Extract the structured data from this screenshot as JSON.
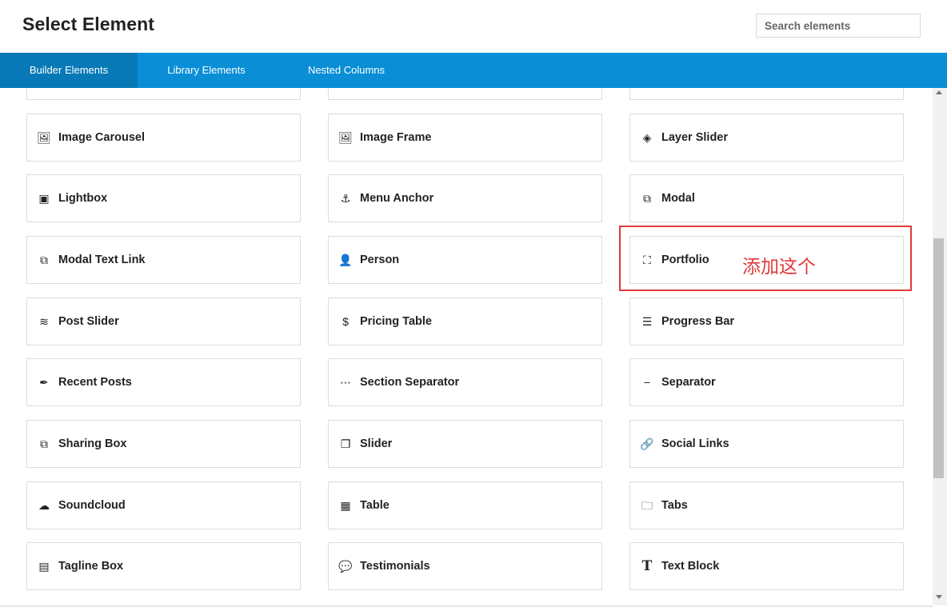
{
  "header": {
    "title": "Select Element",
    "search_placeholder": "Search elements"
  },
  "tabs": [
    {
      "label": "Builder Elements",
      "active": true
    },
    {
      "label": "Library Elements",
      "active": false
    },
    {
      "label": "Nested Columns",
      "active": false
    }
  ],
  "elements": [
    {
      "label": "Image Carousel",
      "icon": "image-icon",
      "glyph": "🖼"
    },
    {
      "label": "Image Frame",
      "icon": "image-icon",
      "glyph": "🖼"
    },
    {
      "label": "Layer Slider",
      "icon": "layers-icon",
      "glyph": "◈"
    },
    {
      "label": "Lightbox",
      "icon": "lightbox-icon",
      "glyph": "▣"
    },
    {
      "label": "Menu Anchor",
      "icon": "anchor-icon",
      "glyph": "⚓"
    },
    {
      "label": "Modal",
      "icon": "external-link-icon",
      "glyph": "⧉"
    },
    {
      "label": "Modal Text Link",
      "icon": "external-link-icon",
      "glyph": "⧉"
    },
    {
      "label": "Person",
      "icon": "person-icon",
      "glyph": "👤"
    },
    {
      "label": "Portfolio",
      "icon": "portfolio-icon",
      "glyph": "⛶"
    },
    {
      "label": "Post Slider",
      "icon": "post-slider-icon",
      "glyph": "≋"
    },
    {
      "label": "Pricing Table",
      "icon": "dollar-icon",
      "glyph": "$"
    },
    {
      "label": "Progress Bar",
      "icon": "progress-bar-icon",
      "glyph": "☰"
    },
    {
      "label": "Recent Posts",
      "icon": "feather-icon",
      "glyph": "✒"
    },
    {
      "label": "Section Separator",
      "icon": "ellipsis-icon",
      "glyph": "⋯"
    },
    {
      "label": "Separator",
      "icon": "minus-icon",
      "glyph": "−"
    },
    {
      "label": "Sharing Box",
      "icon": "share-icon",
      "glyph": "⧉"
    },
    {
      "label": "Slider",
      "icon": "slider-icon",
      "glyph": "❐"
    },
    {
      "label": "Social Links",
      "icon": "link-icon",
      "glyph": "🔗"
    },
    {
      "label": "Soundcloud",
      "icon": "soundcloud-icon",
      "glyph": "☁"
    },
    {
      "label": "Table",
      "icon": "table-icon",
      "glyph": "▦"
    },
    {
      "label": "Tabs",
      "icon": "folder-icon",
      "glyph": "🗀"
    },
    {
      "label": "Tagline Box",
      "icon": "tagline-icon",
      "glyph": "▤"
    },
    {
      "label": "Testimonials",
      "icon": "chat-icon",
      "glyph": "💬"
    },
    {
      "label": "Text Block",
      "icon": "text-icon",
      "glyph": "T"
    }
  ],
  "annotation": {
    "text": "添加这个",
    "color": "#e23a3a"
  },
  "colors": {
    "tab_bar": "#0a8ed5",
    "tab_active": "#0679b6"
  }
}
